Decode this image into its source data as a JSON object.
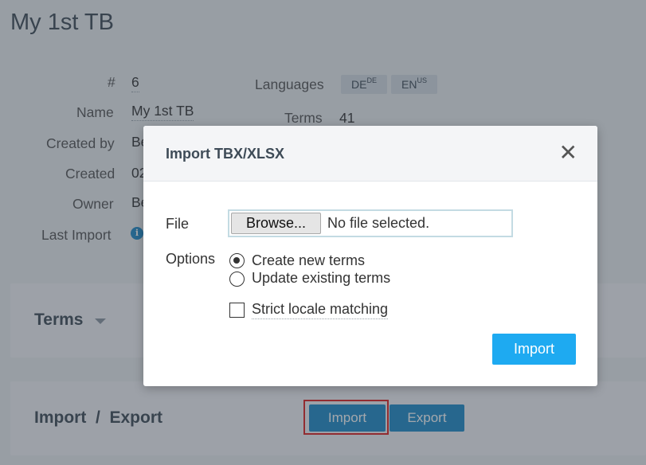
{
  "page": {
    "title": "My 1st TB"
  },
  "details": {
    "id_label": "#",
    "id_value": "6",
    "name_label": "Name",
    "name_value": "My 1st TB",
    "created_by_label": "Created by",
    "created_by_value": "Be",
    "created_label": "Created",
    "created_value": "02",
    "owner_label": "Owner",
    "owner_value": "Be",
    "last_import_label": "Last Import",
    "languages_label": "Languages",
    "languages": [
      {
        "code": "DE",
        "region": "DE"
      },
      {
        "code": "EN",
        "region": "US"
      }
    ],
    "terms_label": "Terms",
    "terms_value": "41"
  },
  "panels": {
    "terms_title": "Terms",
    "import_export_title": "Import  /  Export",
    "import_button": "Import",
    "export_button": "Export"
  },
  "modal": {
    "title": "Import TBX/XLSX",
    "close_symbol": "✕",
    "file_label": "File",
    "browse_button": "Browse...",
    "file_status": "No file selected.",
    "options_label": "Options",
    "option_create": "Create new terms",
    "option_update": "Update existing terms",
    "selected_option": "Create new terms",
    "strict_locale": "Strict locale matching",
    "strict_locale_checked": false,
    "import_button": "Import"
  },
  "colors": {
    "accent": "#1e8bc9",
    "modal_button": "#1eaaf1",
    "highlight": "#e02020"
  }
}
